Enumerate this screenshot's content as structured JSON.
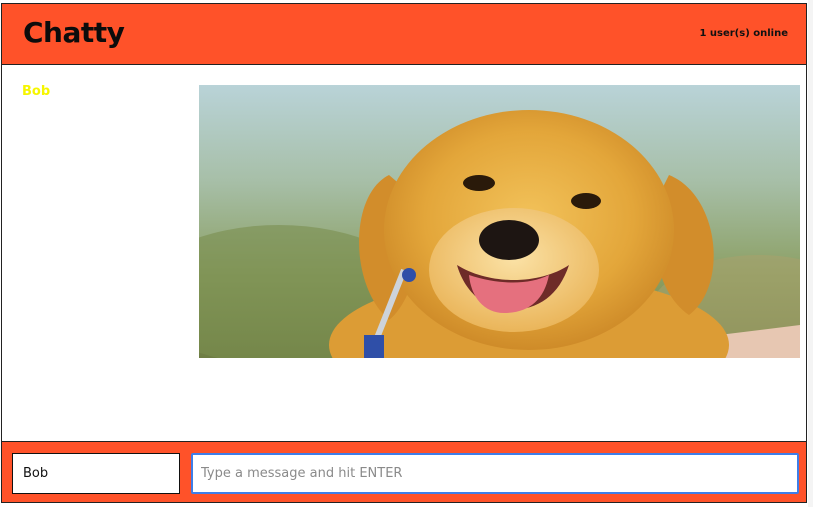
{
  "navbar": {
    "title": "Chatty",
    "online_count": "1 user(s) online"
  },
  "messages": [
    {
      "username": "Bob",
      "username_color": "#f6f600",
      "content_type": "image",
      "image_subject": "golden-retriever-puppy"
    }
  ],
  "composer": {
    "name_value": "Bob",
    "message_placeholder": "Type a message and hit ENTER"
  },
  "colors": {
    "accent": "#ff5229",
    "focus_border": "#3f7ee8"
  }
}
